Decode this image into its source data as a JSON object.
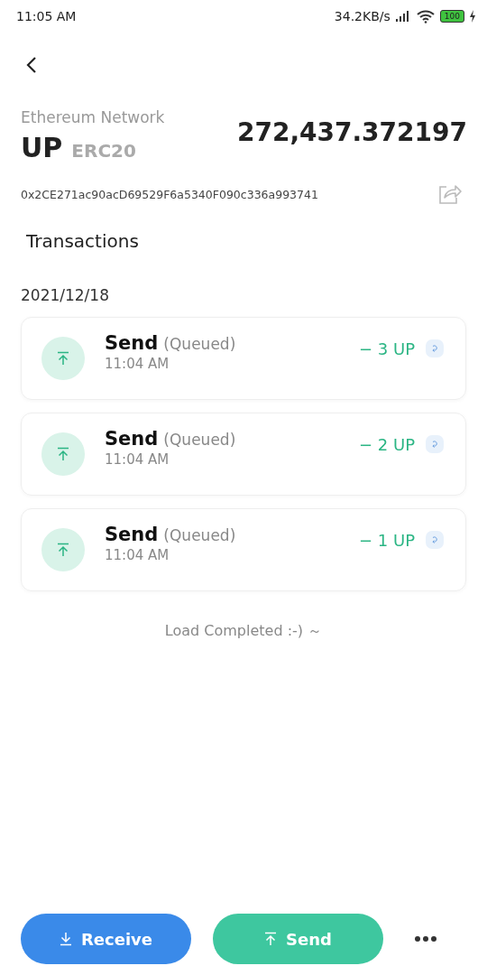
{
  "status_bar": {
    "time": "11:05 AM",
    "speed": "34.2KB/s",
    "battery": "100"
  },
  "token": {
    "network": "Ethereum Network",
    "symbol": "UP",
    "standard": "ERC20",
    "balance": "272,437.372197",
    "address": "0x2CE271ac90acD69529F6a5340F090c336a993741"
  },
  "section_title": "Transactions",
  "groups": [
    {
      "date": "2021/12/18",
      "transactions": [
        {
          "kind": "send",
          "title": "Send",
          "status": "(Queued)",
          "time": "11:04 AM",
          "amount": "− 3 UP"
        },
        {
          "kind": "send",
          "title": "Send",
          "status": "(Queued)",
          "time": "11:04 AM",
          "amount": "− 2 UP"
        },
        {
          "kind": "send",
          "title": "Send",
          "status": "(Queued)",
          "time": "11:04 AM",
          "amount": "− 1 UP"
        }
      ]
    }
  ],
  "footer_note": "Load Completed :-) ～",
  "actions": [
    {
      "kind": "receive",
      "label": "Receive"
    },
    {
      "kind": "send",
      "label": "Send"
    }
  ]
}
